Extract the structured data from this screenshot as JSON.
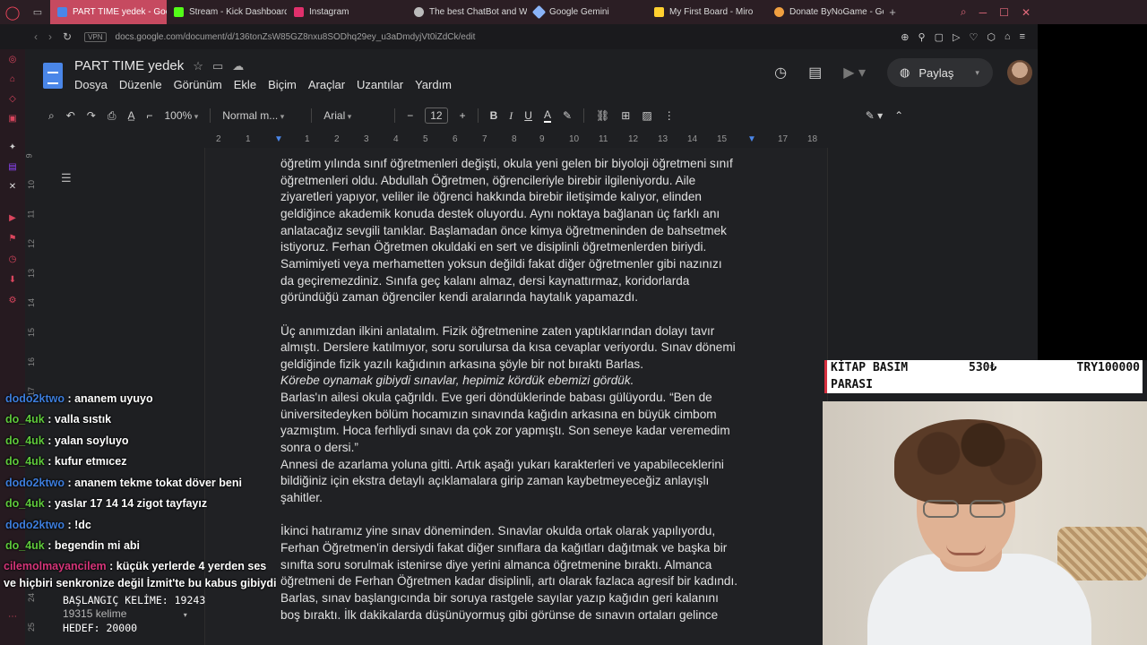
{
  "browser": {
    "tabs": [
      {
        "label": "PART TIME yedek - Goog",
        "color": "#4a86e8",
        "active": true
      },
      {
        "label": "Stream - Kick Dashboard",
        "color": "#53fc18",
        "active": false
      },
      {
        "label": "Instagram",
        "color": "#e1306c",
        "active": false
      },
      {
        "label": "The best ChatBot and W",
        "color": "#bbbbbb",
        "active": false
      },
      {
        "label": "Google Gemini",
        "color": "#8ab4f8",
        "active": false
      },
      {
        "label": "My First Board - Miro",
        "color": "#ffd02f",
        "active": false
      },
      {
        "label": "Donate ByNoGame - Gel",
        "color": "#f0a040",
        "active": false
      }
    ],
    "url": "docs.google.com/document/d/136tonZsW85GZ8nxu8SODhq29ey_u3aDmdyjVt0iZdCk/edit",
    "vpn_label": "VPN"
  },
  "doc": {
    "title": "PART TIME  yedek",
    "menu": [
      "Dosya",
      "Düzenle",
      "Görünüm",
      "Ekle",
      "Biçim",
      "Araçlar",
      "Uzantılar",
      "Yardım"
    ],
    "share_label": "Paylaş",
    "toolbar": {
      "zoom": "100%",
      "style": "Normal m...",
      "font": "Arial",
      "font_size": "12"
    },
    "ruler_numbers": [
      "2",
      "1",
      "1",
      "2",
      "3",
      "4",
      "5",
      "6",
      "7",
      "8",
      "9",
      "10",
      "11",
      "12",
      "13",
      "14",
      "15",
      "16",
      "17",
      "18"
    ],
    "vruler_numbers": [
      "9",
      "10",
      "11",
      "12",
      "13",
      "14",
      "15",
      "16",
      "17",
      "24",
      "25"
    ],
    "lines": [
      "öğretim yılında sınıf öğretmenleri değişti, okula yeni gelen bir biyoloji öğretmeni sınıf",
      "öğretmenleri oldu. Abdullah Öğretmen, öğrencileriyle birebir ilgileniyordu. Aile",
      "ziyaretleri yapıyor, veliler ile öğrenci hakkında birebir iletişimde kalıyor, elinden",
      "geldiğince akademik konuda destek oluyordu. Aynı noktaya bağlanan üç farklı anı",
      "anlatacağız sevgili tanıklar. Başlamadan önce kimya öğretmeninden de bahsetmek",
      "istiyoruz. Ferhan Öğretmen okuldaki en sert ve disiplinli öğretmenlerden biriydi.",
      "Samimiyeti veya merhametten yoksun değildi fakat diğer öğretmenler gibi nazınızı",
      "da geçiremezdiniz. Sınıfa geç kalanı almaz, dersi kaynattırmaz, koridorlarda",
      "göründüğü zaman öğrenciler kendi aralarında haytalık yapamazdı.",
      "",
      "Üç anımızdan ilkini anlatalım. Fizik öğretmenine zaten yaptıklarından dolayı tavır",
      "almıştı. Derslere katılmıyor, soru sorulursa da kısa cevaplar veriyordu. Sınav dönemi",
      "geldiğinde fizik yazılı kağıdının arkasına şöyle bir not bıraktı Barlas.",
      "Körebe oynamak gibiydi sınavlar, hepimiz kördük ebemizi gördük.",
      "Barlas'ın ailesi okula çağrıldı. Eve geri döndüklerinde babası gülüyordu. “Ben de",
      "üniversitedeyken bölüm hocamızın sınavında kağıdın arkasına en büyük cimbom",
      "yazmıştım. Hoca ferhliydi sınavı da çok zor yapmıştı. Son seneye kadar veremedim",
      "sonra o dersi.”",
      "Annesi de azarlama yoluna gitti. Artık aşağı yukarı karakterleri ve yapabileceklerini",
      "bildiğiniz için ekstra detaylı açıklamalara girip zaman kaybetmeyeceğiz anlayışlı",
      "şahitler.",
      "",
      "İkinci hatıramız yine sınav döneminden. Sınavlar okulda ortak olarak yapılıyordu,",
      "Ferhan Öğretmen'in dersiydi fakat diğer sınıflara da kağıtları dağıtmak ve başka bir",
      "sınıfta soru sorulmak istenirse diye yerini almanca öğretmenine bıraktı. Almanca",
      "öğretmeni de Ferhan Öğretmen kadar disiplinli, artı olarak fazlaca agresif bir kadındı.",
      "Barlas, sınav başlangıcında bir soruya rastgele sayılar yazıp kağıdın geri kalanını",
      "boş bıraktı. İlk dakikalarda düşünüyormuş gibi görünse de sınavın ortaları gelince"
    ],
    "italic_line_index": 13
  },
  "overlay": {
    "donation": {
      "line1": "KİTAP BASIM",
      "line2": "PARASI",
      "current": "530₺",
      "goal": "TRY100000"
    },
    "counter": {
      "start": "BAŞLANGIÇ KELİME: 19243",
      "words": "19315 kelime",
      "target": "HEDEF: 20000"
    },
    "chat": [
      {
        "user": "dodo2ktwo",
        "text": " : ananem uyuyo",
        "color": "blue"
      },
      {
        "user": "do_4uk",
        "text": " : valla sıstık",
        "color": "green"
      },
      {
        "user": "do_4uk",
        "text": " : yalan soyluyo",
        "color": "green"
      },
      {
        "user": "do_4uk",
        "text": " : kufur etmıcez",
        "color": "green"
      },
      {
        "user": "dodo2ktwo",
        "text": " : ananem tekme tokat döver beni",
        "color": "blue"
      },
      {
        "user": "do_4uk",
        "text": " : yaslar 17 14 14 zigot tayfayız",
        "color": "green"
      },
      {
        "user": "dodo2ktwo",
        "text": " : !dc",
        "color": "blue"
      },
      {
        "user": "do_4uk",
        "text": " : begendin mi abi",
        "color": "green"
      },
      {
        "user": "cilemolmayancilem",
        "text": " : küçük yerlerde 4 yerden ses ve hiçbiri senkronize değil İzmit'te bu kabus gibiydi",
        "color": "pink"
      }
    ]
  }
}
